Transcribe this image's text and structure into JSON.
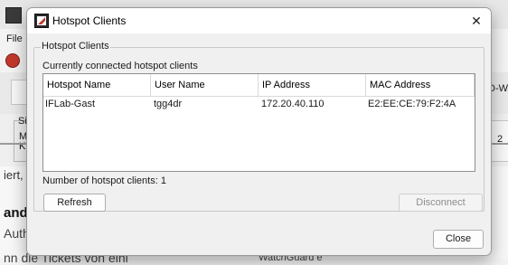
{
  "background": {
    "menu_file": "File",
    "partial_right": "D-WA",
    "partial_s": "Si",
    "partial_m": "M",
    "partial_k": "K",
    "partial_number": "2",
    "partial_iert": "iert,",
    "partial_and": "and",
    "partial_auth": "Auth",
    "partial_bottom_left": "nn die Tickets von eini",
    "partial_bottom_right": "WatchGuard e"
  },
  "dialog": {
    "title": "Hotspot Clients",
    "group_label": "Hotspot Clients",
    "list_caption": "Currently connected hotspot clients",
    "columns": [
      "Hotspot Name",
      "User Name",
      "IP Address",
      "MAC Address"
    ],
    "rows": [
      [
        "IFLab-Gast",
        "tgg4dr",
        "172.20.40.110",
        "E2:EE:CE:79:F2:4A"
      ]
    ],
    "count_label": "Number of hotspot clients: 1",
    "buttons": {
      "refresh": "Refresh",
      "disconnect": "Disconnect",
      "close": "Close"
    }
  },
  "colors": {
    "app_icon_red": "#c0392b",
    "dialog_bg": "#f0f0f0",
    "titlebar_bg": "#ffffff"
  }
}
